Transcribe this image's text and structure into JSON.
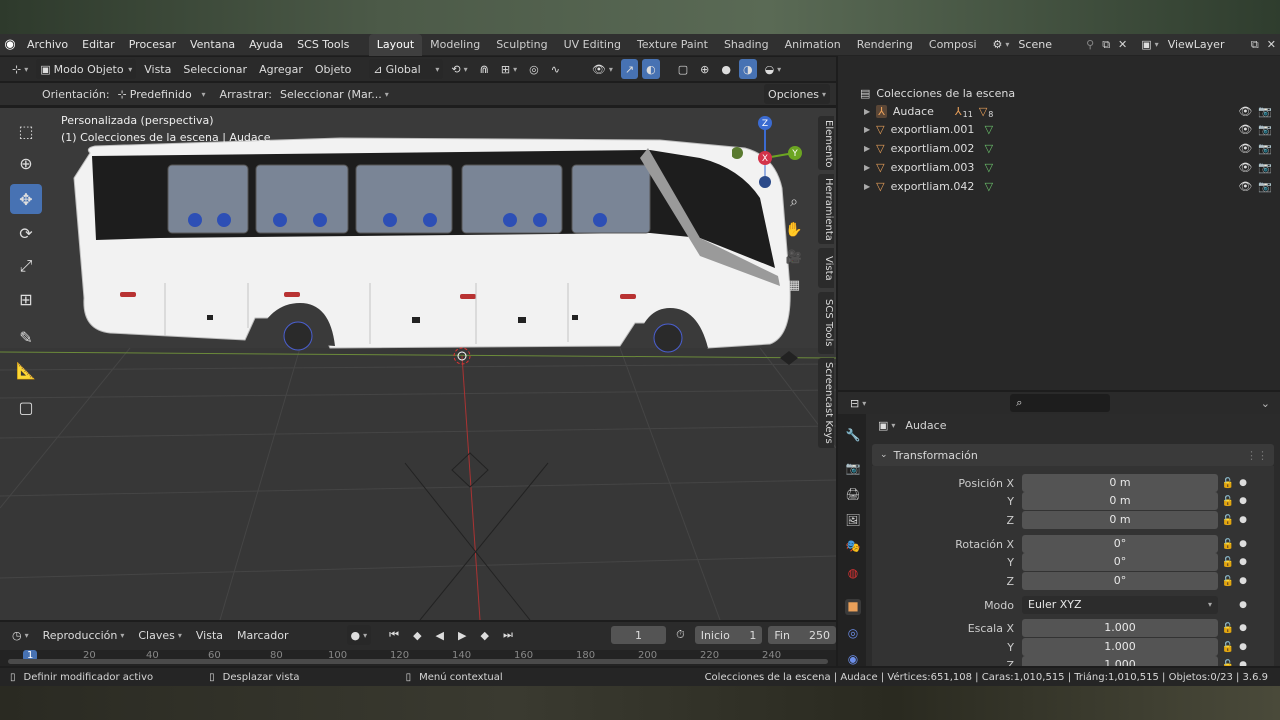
{
  "menu": {
    "items": [
      "Archivo",
      "Editar",
      "Procesar",
      "Ventana",
      "Ayuda",
      "SCS Tools"
    ]
  },
  "workspaces": {
    "tabs": [
      "Layout",
      "Modeling",
      "Sculpting",
      "UV Editing",
      "Texture Paint",
      "Shading",
      "Animation",
      "Rendering",
      "Composi"
    ],
    "active": "Layout"
  },
  "scene": {
    "label": "Scene",
    "viewlayer": "ViewLayer"
  },
  "viewport_header": {
    "mode": "Modo Objeto",
    "menus": [
      "Vista",
      "Seleccionar",
      "Agregar",
      "Objeto"
    ],
    "orientation": "Global"
  },
  "tool_settings": {
    "orientation_label": "Orientación:",
    "orientation_value": "Predefinido",
    "drag_label": "Arrastrar:",
    "drag_value": "Seleccionar (Mar...",
    "options": "Opciones"
  },
  "overlay": {
    "line1": "Personalizada (perspectiva)",
    "line2": "(1) Colecciones de la escena | Audace"
  },
  "sidebar_tabs": [
    "Elemento",
    "Herramienta",
    "Vista",
    "SCS Tools",
    "Screencast Keys"
  ],
  "gizmo": {
    "z": "Z",
    "y": "Y",
    "x": "X"
  },
  "outliner": {
    "root": "Colecciones de la escena",
    "items": [
      {
        "name": "Audace",
        "extra1": "11",
        "extra2": "8"
      },
      {
        "name": "exportliam.001"
      },
      {
        "name": "exportliam.002"
      },
      {
        "name": "exportliam.003"
      },
      {
        "name": "exportliam.042"
      }
    ]
  },
  "properties": {
    "object_name": "Audace",
    "section": "Transformación",
    "rows": [
      {
        "label": "Posición X",
        "value": "0 m"
      },
      {
        "label": "Y",
        "value": "0 m"
      },
      {
        "label": "Z",
        "value": "0 m"
      },
      {
        "label": "Rotación X",
        "value": "0°"
      },
      {
        "label": "Y",
        "value": "0°"
      },
      {
        "label": "Z",
        "value": "0°"
      },
      {
        "label": "Modo",
        "value": "Euler XYZ"
      },
      {
        "label": "Escala X",
        "value": "1.000"
      },
      {
        "label": "Y",
        "value": "1.000"
      },
      {
        "label": "Z",
        "value": "1.000"
      }
    ]
  },
  "timeline": {
    "menus": [
      "Reproducción",
      "Claves",
      "Vista",
      "Marcador"
    ],
    "current_frame": "1",
    "start_label": "Inicio",
    "start": "1",
    "end_label": "Fin",
    "end": "250",
    "ruler": [
      "1",
      "20",
      "40",
      "60",
      "80",
      "100",
      "120",
      "140",
      "160",
      "180",
      "200",
      "220",
      "240"
    ]
  },
  "status": {
    "left1": "Definir modificador activo",
    "left2": "Desplazar vista",
    "left3": "Menú contextual",
    "stats": "Colecciones de la escena | Audace | Vértices:651,108 | Caras:1,010,515 | Triáng:1,010,515 | Objetos:0/23 | 3.6.9"
  },
  "colors": {
    "accent": "#4772b3",
    "header": "#303030",
    "viewport": "#3c3c3c",
    "panel": "#282828"
  }
}
